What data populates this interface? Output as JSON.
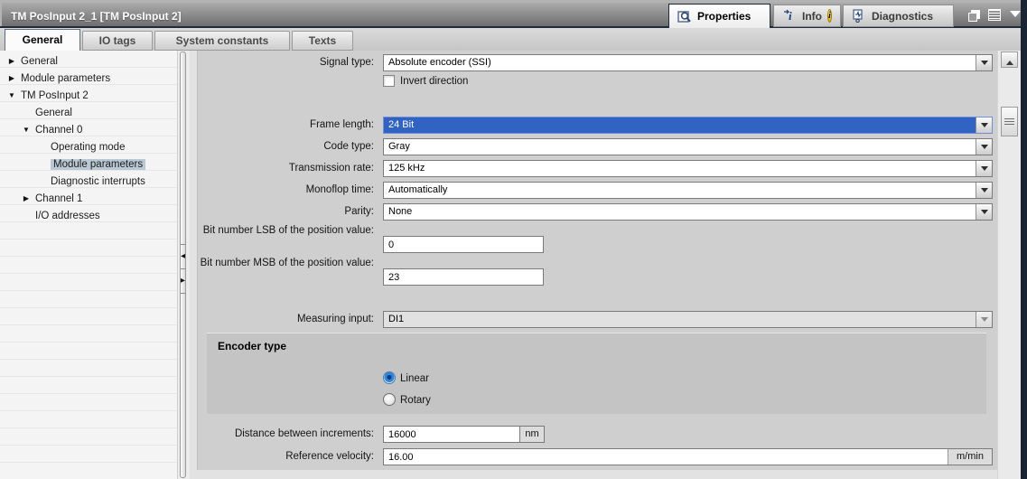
{
  "window": {
    "title": "TM PosInput 2_1 [TM PosInput 2]",
    "properties_tab": "Properties",
    "info_tab": "Info",
    "info_badge": "i",
    "diagnostics_tab": "Diagnostics",
    "window_icons": [
      "duplicate-panel-icon",
      "list-icon",
      "chevron-down-icon"
    ]
  },
  "tabs": [
    {
      "label": "General",
      "active": true
    },
    {
      "label": "IO tags",
      "active": false
    },
    {
      "label": "System constants",
      "active": false
    },
    {
      "label": "Texts",
      "active": false
    }
  ],
  "sidebar": {
    "items": [
      {
        "label": "General",
        "level": 0,
        "expander": "collapsed"
      },
      {
        "label": "Module parameters",
        "level": 0,
        "expander": "collapsed"
      },
      {
        "label": "TM PosInput 2",
        "level": 0,
        "expander": "expanded"
      },
      {
        "label": "General",
        "level": 1,
        "expander": "none"
      },
      {
        "label": "Channel 0",
        "level": 1,
        "expander": "expanded"
      },
      {
        "label": "Operating mode",
        "level": 2,
        "expander": "none"
      },
      {
        "label": "Module parameters",
        "level": 2,
        "expander": "none",
        "selected": true
      },
      {
        "label": "Diagnostic interrupts",
        "level": 2,
        "expander": "none"
      },
      {
        "label": "Channel 1",
        "level": 1,
        "expander": "collapsed"
      },
      {
        "label": "I/O addresses",
        "level": 1,
        "expander": "none"
      }
    ]
  },
  "form": {
    "signal_type": {
      "label": "Signal type:",
      "value": "Absolute encoder (SSI)"
    },
    "invert_direction": {
      "label": "Invert direction",
      "checked": false
    },
    "frame_length": {
      "label": "Frame length:",
      "value": "24 Bit",
      "highlighted": true
    },
    "code_type": {
      "label": "Code type:",
      "value": "Gray"
    },
    "transmission_rate": {
      "label": "Transmission rate:",
      "value": "125 kHz"
    },
    "monoflop_time": {
      "label": "Monoflop time:",
      "value": "Automatically"
    },
    "parity": {
      "label": "Parity:",
      "value": "None"
    },
    "bit_lsb": {
      "label": "Bit number LSB of the position value:",
      "value": "0"
    },
    "bit_msb": {
      "label": "Bit number MSB of the position value:",
      "value": "23"
    },
    "measuring_input": {
      "label": "Measuring input:",
      "value": "DI1",
      "disabled": true
    },
    "encoder_type": {
      "title": "Encoder type",
      "options": [
        {
          "label": "Linear",
          "selected": true
        },
        {
          "label": "Rotary",
          "selected": false
        }
      ]
    },
    "distance_between_increments": {
      "label": "Distance between increments:",
      "value": "16000",
      "unit": "nm"
    },
    "reference_velocity": {
      "label": "Reference velocity:",
      "value": "16.00",
      "unit": "m/min"
    }
  },
  "colors": {
    "selection_blue": "#3163c5",
    "sidebar_selection": "#b9c8d3",
    "panel_gray": "#cfcfcf",
    "section_gray": "#c4c4c4",
    "titlebar_underline": "#1e2b3c",
    "edge_navy": "#1b2433",
    "info_badge_yellow": "#f2c200"
  }
}
